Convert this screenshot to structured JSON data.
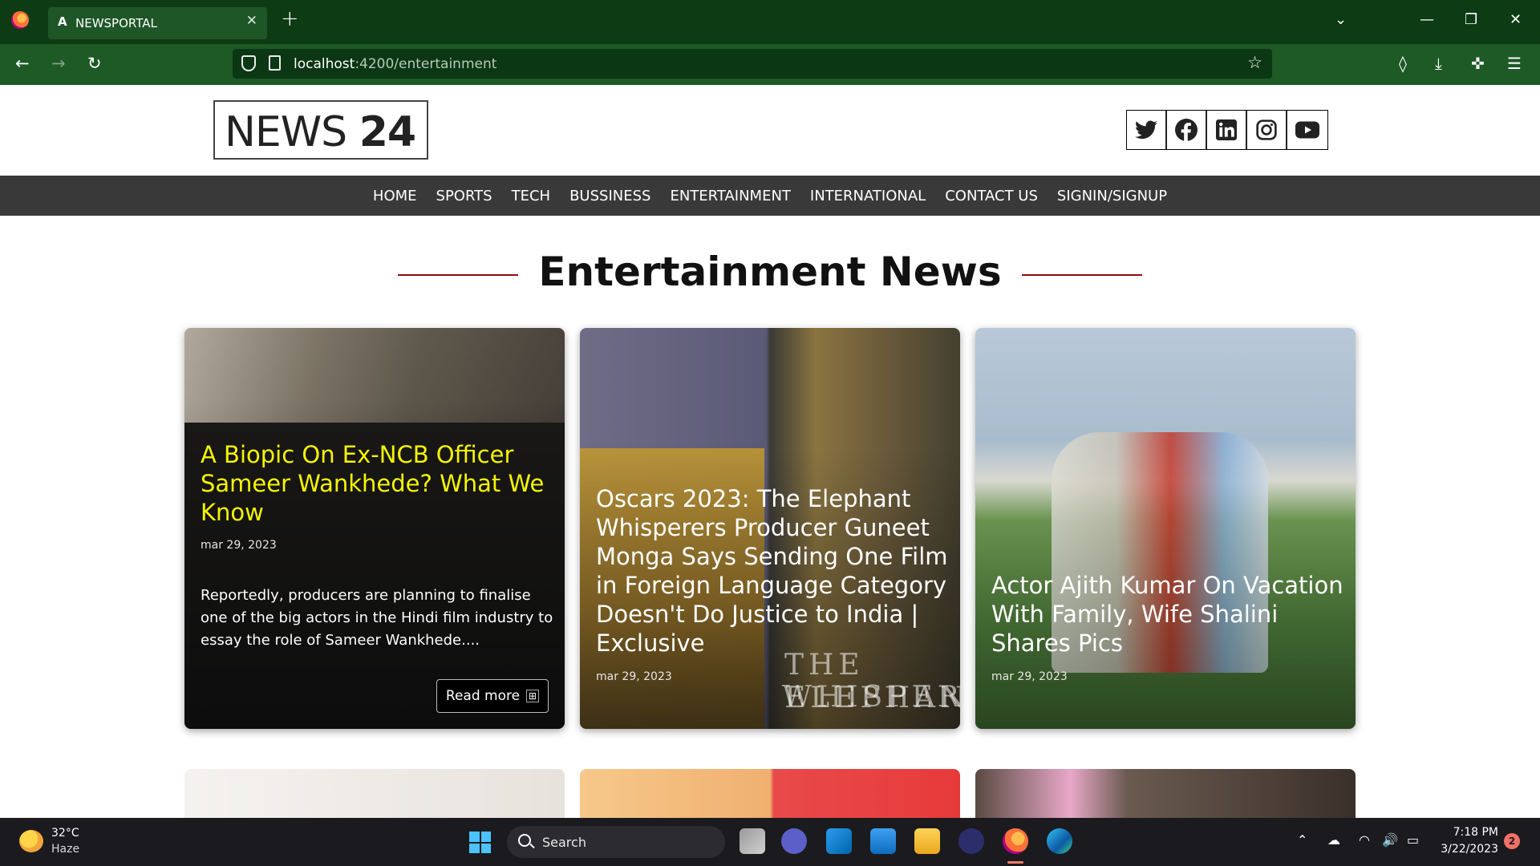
{
  "browser": {
    "tab_title": "NEWSPORTAL",
    "tab_icon": "A",
    "url_host": "localhost",
    "url_rest": ":4200/entertainment"
  },
  "site": {
    "logo_light": "NEWS ",
    "logo_bold": "24",
    "social": [
      "twitter-icon",
      "facebook-icon",
      "linkedin-icon",
      "instagram-icon",
      "youtube-icon"
    ],
    "menu": [
      "HOME",
      "SPORTS",
      "TECH",
      "BUSSINESS",
      "ENTERTAINMENT",
      "INTERNATIONAL",
      "CONTACT US",
      "SIGNIN/SIGNUP"
    ],
    "heading": "Entertainment News",
    "accent_color": "#8f0c0c"
  },
  "cards": [
    {
      "title": "A Biopic On Ex-NCB Officer Sameer Wankhede? What We Know",
      "date": "mar 29, 2023",
      "description": "Reportedly, producers are planning to finalise one of the big actors in the Hindi film industry to essay the role of Sameer Wankhede....",
      "button": "Read more",
      "title_color": "#f5f500"
    },
    {
      "title": "Oscars 2023: The Elephant Whisperers Producer Guneet Monga Says Sending One Film in Foreign Language Category Doesn't Do Justice to India | Exclusive",
      "date": "mar 29, 2023",
      "image_text_1": "THE ELEPHAN",
      "image_text_2": "WHISPERE"
    },
    {
      "title": "Actor Ajith Kumar On Vacation With Family, Wife Shalini Shares Pics",
      "date": "mar 29, 2023"
    }
  ],
  "taskbar": {
    "temperature": "32°C",
    "weather": "Haze",
    "search_placeholder": "Search",
    "time": "7:18 PM",
    "date": "3/22/2023",
    "notifications": "2"
  }
}
